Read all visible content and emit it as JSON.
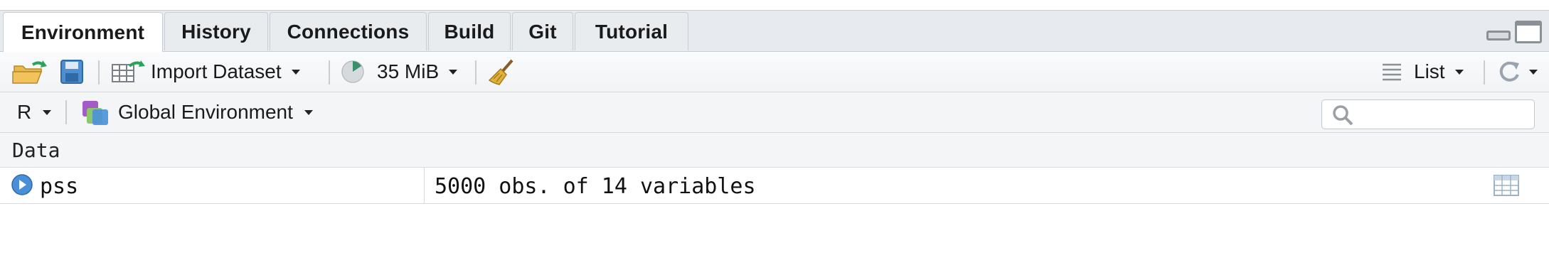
{
  "tabs": [
    {
      "label": "Environment",
      "active": true
    },
    {
      "label": "History",
      "active": false
    },
    {
      "label": "Connections",
      "active": false
    },
    {
      "label": "Build",
      "active": false
    },
    {
      "label": "Git",
      "active": false
    },
    {
      "label": "Tutorial",
      "active": false
    }
  ],
  "toolbar": {
    "open_icon": "folder-open-icon",
    "save_icon": "save-disk-icon",
    "import_label": "Import Dataset",
    "memory_label": "35 MiB",
    "broom_icon": "broom-clear-icon",
    "view_mode_label": "List",
    "refresh_icon": "refresh-icon"
  },
  "env_bar": {
    "language_label": "R",
    "environment_label": "Global Environment",
    "search_placeholder": ""
  },
  "section": {
    "title": "Data"
  },
  "rows": [
    {
      "name": "pss",
      "value": "5000 obs. of 14 variables"
    }
  ],
  "colors": {
    "tabbar_bg": "#e7eaee",
    "active_tab_bg": "#ffffff",
    "accent_blue": "#4a90d9",
    "import_green": "#27a35a"
  }
}
